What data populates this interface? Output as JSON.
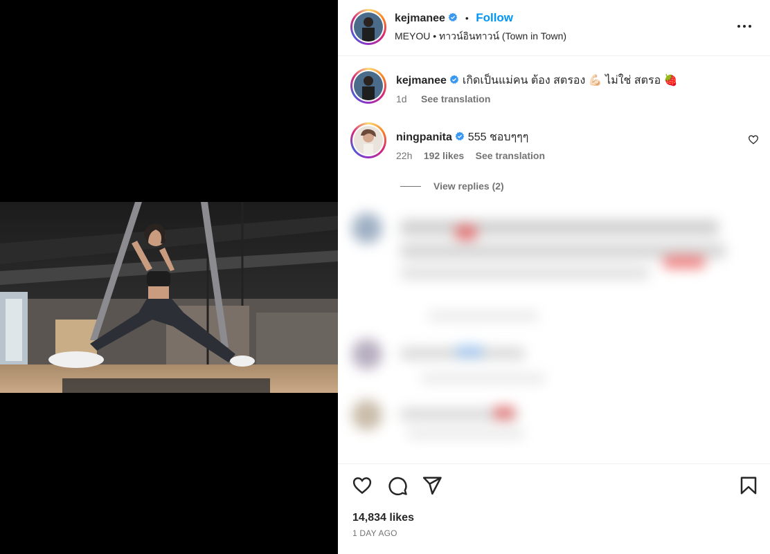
{
  "post": {
    "author": "kejmanee",
    "follow_label": "Follow",
    "dot": "•",
    "location_line": "MEYOU • ทาวน์อินทาวน์ (Town in Town)"
  },
  "caption": {
    "username": "kejmanee",
    "text": "เกิดเป็นแม่คน ต้อง สตรอง 💪🏻 ไม่ใช่ สตรอ 🍓",
    "time": "1d",
    "see_translation": "See translation"
  },
  "comment": {
    "username": "ningpanita",
    "text": "555 ชอบๆๆๆ",
    "time": "22h",
    "likes": "192 likes",
    "see_translation": "See translation",
    "view_replies": "View replies (2)"
  },
  "footer": {
    "likes": "14,834 likes",
    "date": "1 DAY AGO"
  },
  "colors": {
    "accent": "#0095f6",
    "verified": "#3897f0",
    "muted": "#737373"
  },
  "icons": [
    "more-options-icon",
    "heart-icon",
    "comment-icon",
    "share-icon",
    "bookmark-icon",
    "verified-badge-icon"
  ]
}
